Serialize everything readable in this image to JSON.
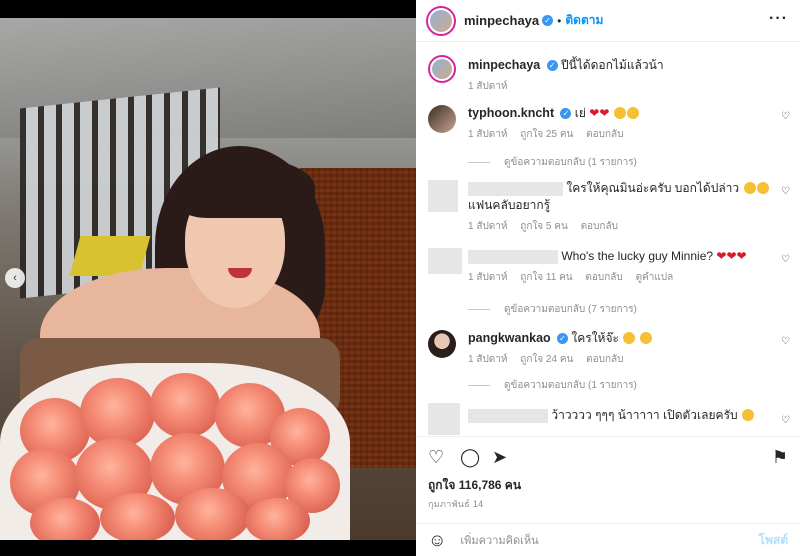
{
  "header": {
    "username": "minpechaya",
    "verified_glyph": "✓",
    "separator": "•",
    "follow_label": "ติดตาม",
    "more_label": "···"
  },
  "caption": {
    "username": "minpechaya",
    "text": "ปีนี้ได้ดอกไม้แล้วน้า",
    "time": "1 สัปดาห์"
  },
  "comments": [
    {
      "username": "typhoon.kncht",
      "verified": true,
      "text": "เย่",
      "time": "1 สัปดาห์",
      "likes": "ถูกใจ 25 คน",
      "reply": "ตอบกลับ",
      "view_replies": "ดูข้อความตอบกลับ (1 รายการ)"
    },
    {
      "username": "",
      "text": "ใครให้คุณมินอ่ะครับ บอกได้ปล่าว",
      "text2": "แฟนคลับอยากรู้",
      "time": "1 สัปดาห์",
      "likes": "ถูกใจ 5 คน",
      "reply": "ตอบกลับ"
    },
    {
      "username": "",
      "text": "Who's the lucky guy Minnie?",
      "time": "1 สัปดาห์",
      "likes": "ถูกใจ 11 คน",
      "reply": "ตอบกลับ",
      "translate": "ดูคำแปล",
      "view_replies": "ดูข้อความตอบกลับ (7 รายการ)"
    },
    {
      "username": "pangkwankao",
      "verified": true,
      "text": "ใครให้จ๊ะ",
      "time": "1 สัปดาห์",
      "likes": "ถูกใจ 24 คน",
      "reply": "ตอบกลับ",
      "view_replies": "ดูข้อความตอบกลับ (1 รายการ)"
    },
    {
      "username": "",
      "text": "ว้าวววว ๆๆๆ น้าาาาา เปิดตัวเลยครับ"
    }
  ],
  "footer": {
    "likes": "ถูกใจ 116,786 คน",
    "date": "กุมภาพันธ์ 14",
    "comment_placeholder": "เพิ่มความคิดเห็น",
    "post_label": "โพสต์"
  },
  "icons": {
    "heart": "♡",
    "comment": "◯",
    "share": "➤",
    "save": "⚑",
    "smile": "☺",
    "nav_left": "‹"
  },
  "colors": {
    "accent": "#0095f6",
    "verified": "#3897f0",
    "muted": "#8e8e8e",
    "heart_emoji": "#e0172b"
  }
}
